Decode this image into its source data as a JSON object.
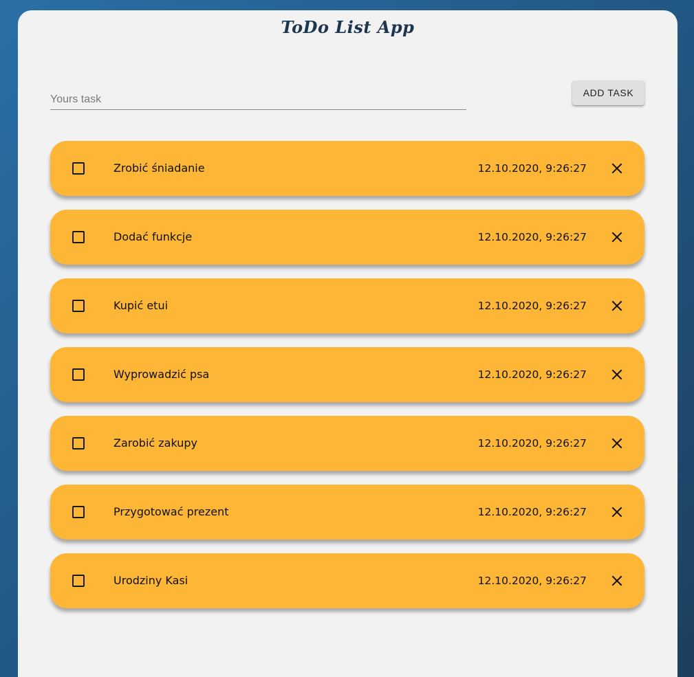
{
  "app": {
    "title": "ToDo List App"
  },
  "form": {
    "input_value": "",
    "input_placeholder": "Yours task",
    "add_button_label": "ADD TASK"
  },
  "colors": {
    "task_background": "#fdb636",
    "card_background": "#f2f2f2",
    "title_color": "#1e3550"
  },
  "tasks": [
    {
      "name": "Zrobić śniadanie",
      "date": "12.10.2020, 9:26:27",
      "done": false
    },
    {
      "name": "Dodać funkcje",
      "date": "12.10.2020, 9:26:27",
      "done": false
    },
    {
      "name": "Kupić etui",
      "date": "12.10.2020, 9:26:27",
      "done": false
    },
    {
      "name": "Wyprowadzić psa",
      "date": "12.10.2020, 9:26:27",
      "done": false
    },
    {
      "name": "Zarobić zakupy",
      "date": "12.10.2020, 9:26:27",
      "done": false
    },
    {
      "name": "Przygotować prezent",
      "date": "12.10.2020, 9:26:27",
      "done": false
    },
    {
      "name": "Urodziny Kasi",
      "date": "12.10.2020, 9:26:27",
      "done": false
    }
  ],
  "icons": {
    "checkbox": "checkbox-unchecked-icon",
    "delete": "close-icon"
  }
}
